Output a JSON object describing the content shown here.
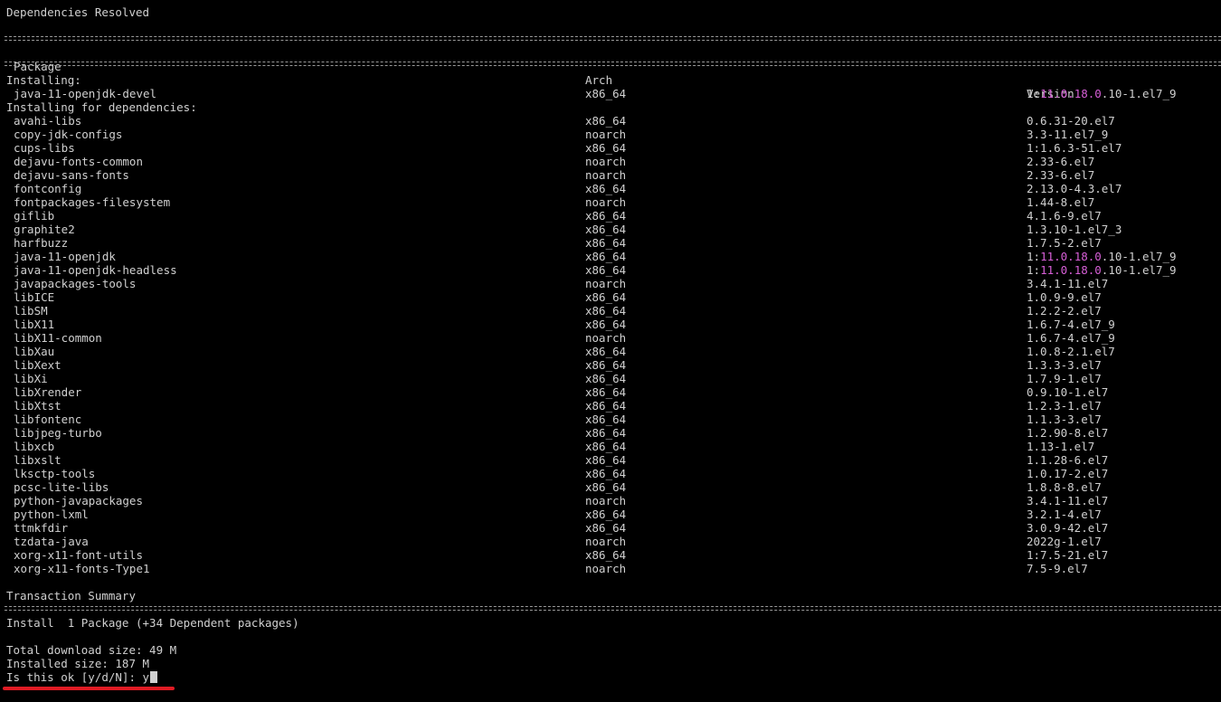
{
  "status": "Dependencies Resolved",
  "table": {
    "headers": {
      "package": "Package",
      "arch": "Arch",
      "version": "Version"
    },
    "installing_label": "Installing:",
    "installing": [
      {
        "package": "java-11-openjdk-devel",
        "arch": "x86_64",
        "version": [
          "1:",
          "11.0.18.0",
          ".10-1.el7_9"
        ]
      }
    ],
    "deps_label": "Installing for dependencies:",
    "dependencies": [
      {
        "package": "avahi-libs",
        "arch": "x86_64",
        "version": [
          "0.6.31-20.el7"
        ]
      },
      {
        "package": "copy-jdk-configs",
        "arch": "noarch",
        "version": [
          "3.3-11.el7_9"
        ]
      },
      {
        "package": "cups-libs",
        "arch": "x86_64",
        "version": [
          "1:1.6.3-51.el7"
        ]
      },
      {
        "package": "dejavu-fonts-common",
        "arch": "noarch",
        "version": [
          "2.33-6.el7"
        ]
      },
      {
        "package": "dejavu-sans-fonts",
        "arch": "noarch",
        "version": [
          "2.33-6.el7"
        ]
      },
      {
        "package": "fontconfig",
        "arch": "x86_64",
        "version": [
          "2.13.0-4.3.el7"
        ]
      },
      {
        "package": "fontpackages-filesystem",
        "arch": "noarch",
        "version": [
          "1.44-8.el7"
        ]
      },
      {
        "package": "giflib",
        "arch": "x86_64",
        "version": [
          "4.1.6-9.el7"
        ]
      },
      {
        "package": "graphite2",
        "arch": "x86_64",
        "version": [
          "1.3.10-1.el7_3"
        ]
      },
      {
        "package": "harfbuzz",
        "arch": "x86_64",
        "version": [
          "1.7.5-2.el7"
        ]
      },
      {
        "package": "java-11-openjdk",
        "arch": "x86_64",
        "version": [
          "1:",
          "11.0.18.0",
          ".10-1.el7_9"
        ]
      },
      {
        "package": "java-11-openjdk-headless",
        "arch": "x86_64",
        "version": [
          "1:",
          "11.0.18.0",
          ".10-1.el7_9"
        ]
      },
      {
        "package": "javapackages-tools",
        "arch": "noarch",
        "version": [
          "3.4.1-11.el7"
        ]
      },
      {
        "package": "libICE",
        "arch": "x86_64",
        "version": [
          "1.0.9-9.el7"
        ]
      },
      {
        "package": "libSM",
        "arch": "x86_64",
        "version": [
          "1.2.2-2.el7"
        ]
      },
      {
        "package": "libX11",
        "arch": "x86_64",
        "version": [
          "1.6.7-4.el7_9"
        ]
      },
      {
        "package": "libX11-common",
        "arch": "noarch",
        "version": [
          "1.6.7-4.el7_9"
        ]
      },
      {
        "package": "libXau",
        "arch": "x86_64",
        "version": [
          "1.0.8-2.1.el7"
        ]
      },
      {
        "package": "libXext",
        "arch": "x86_64",
        "version": [
          "1.3.3-3.el7"
        ]
      },
      {
        "package": "libXi",
        "arch": "x86_64",
        "version": [
          "1.7.9-1.el7"
        ]
      },
      {
        "package": "libXrender",
        "arch": "x86_64",
        "version": [
          "0.9.10-1.el7"
        ]
      },
      {
        "package": "libXtst",
        "arch": "x86_64",
        "version": [
          "1.2.3-1.el7"
        ]
      },
      {
        "package": "libfontenc",
        "arch": "x86_64",
        "version": [
          "1.1.3-3.el7"
        ]
      },
      {
        "package": "libjpeg-turbo",
        "arch": "x86_64",
        "version": [
          "1.2.90-8.el7"
        ]
      },
      {
        "package": "libxcb",
        "arch": "x86_64",
        "version": [
          "1.13-1.el7"
        ]
      },
      {
        "package": "libxslt",
        "arch": "x86_64",
        "version": [
          "1.1.28-6.el7"
        ]
      },
      {
        "package": "lksctp-tools",
        "arch": "x86_64",
        "version": [
          "1.0.17-2.el7"
        ]
      },
      {
        "package": "pcsc-lite-libs",
        "arch": "x86_64",
        "version": [
          "1.8.8-8.el7"
        ]
      },
      {
        "package": "python-javapackages",
        "arch": "noarch",
        "version": [
          "3.4.1-11.el7"
        ]
      },
      {
        "package": "python-lxml",
        "arch": "x86_64",
        "version": [
          "3.2.1-4.el7"
        ]
      },
      {
        "package": "ttmkfdir",
        "arch": "x86_64",
        "version": [
          "3.0.9-42.el7"
        ]
      },
      {
        "package": "tzdata-java",
        "arch": "noarch",
        "version": [
          "2022g-1.el7"
        ]
      },
      {
        "package": "xorg-x11-font-utils",
        "arch": "x86_64",
        "version": [
          "1:7.5-21.el7"
        ]
      },
      {
        "package": "xorg-x11-fonts-Type1",
        "arch": "noarch",
        "version": [
          "7.5-9.el7"
        ]
      }
    ]
  },
  "summary": {
    "title": "Transaction Summary",
    "install_line": "Install  1 Package (+34 Dependent packages)",
    "download_size": "Total download size: 49 M",
    "installed_size": "Installed size: 187 M",
    "prompt": "Is this ok [y/d/N]: ",
    "prompt_input": "y"
  },
  "colors": {
    "background": "#000000",
    "text": "#d0d0d0",
    "version_highlight": "#d75fd7",
    "annotation_underline": "#e01b24"
  }
}
